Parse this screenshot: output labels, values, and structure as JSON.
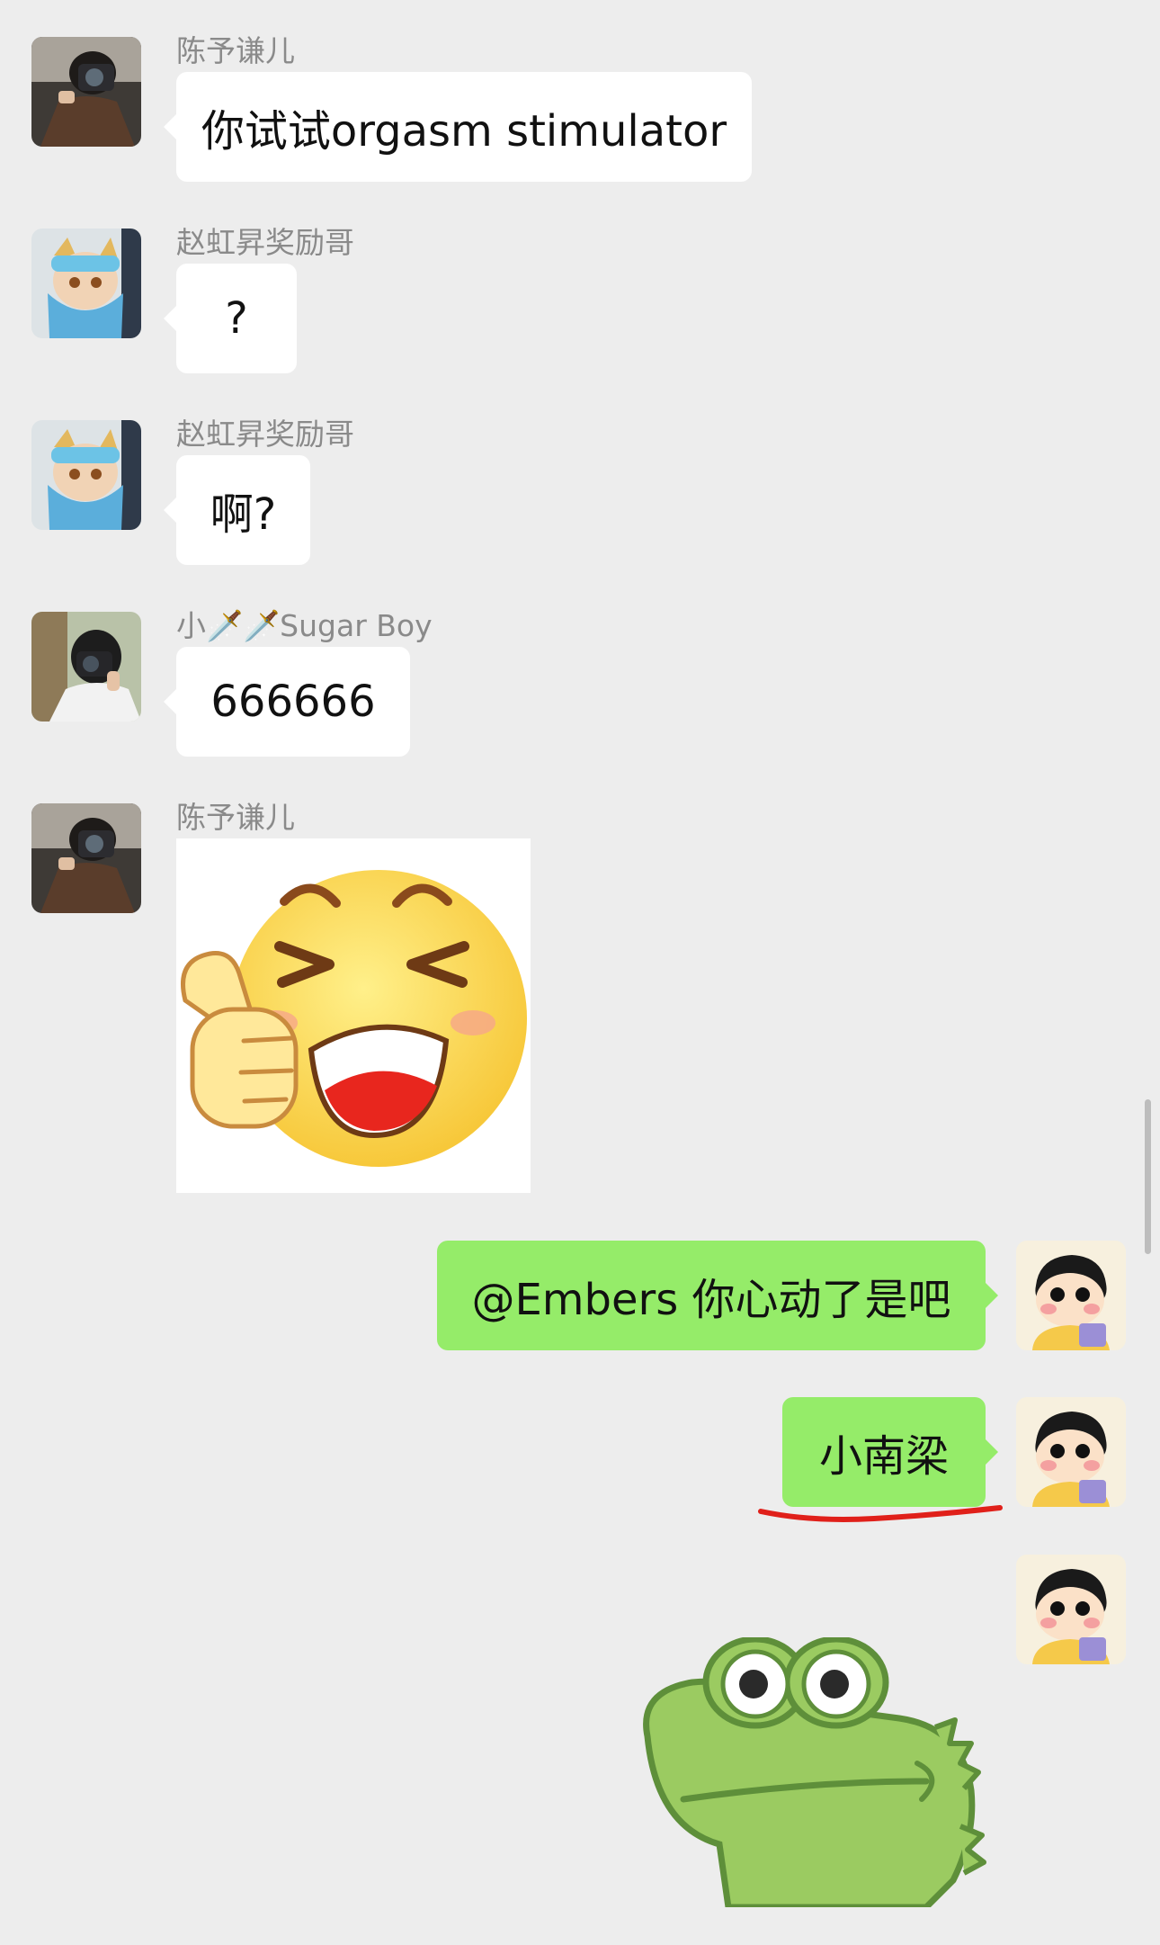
{
  "messages": [
    {
      "sender": "陈予谦儿",
      "text": "你试试orgasm stimulator"
    },
    {
      "sender": "赵虹昇奖励哥",
      "text": "?"
    },
    {
      "sender": "赵虹昇奖励哥",
      "text": "啊?"
    },
    {
      "sender": "小🗡️🗡️Sugar Boy",
      "text": "666666"
    },
    {
      "sender": "陈予谦儿",
      "sticker": "thumbs-up-laughing-emoji"
    }
  ],
  "own_messages": [
    {
      "text": "@Embers 你心动了是吧"
    },
    {
      "text": "小南梁",
      "annotation": "red-underline"
    },
    {
      "sticker": "green-crocodile-sticker"
    }
  ],
  "colors": {
    "background": "#EDEDED",
    "incoming_bubble": "#FFFFFF",
    "outgoing_bubble": "#95EC69",
    "sender_name": "#8A8A8A",
    "annotation_red": "#E0201A"
  }
}
